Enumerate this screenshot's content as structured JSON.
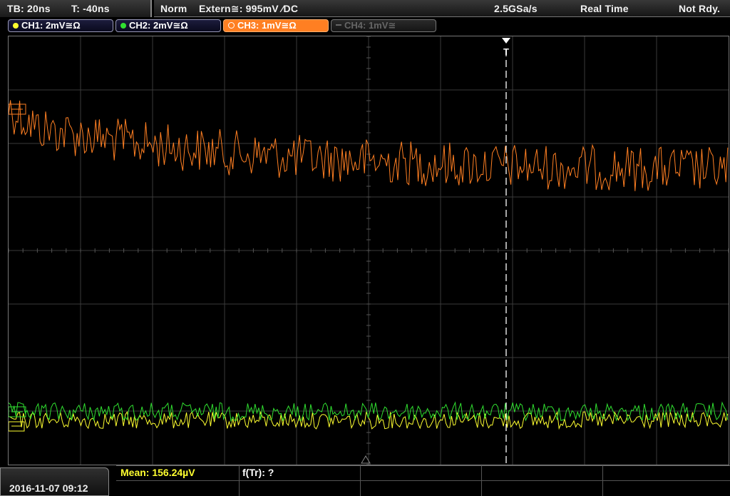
{
  "topbar": {
    "timebase": "TB: 20ns",
    "trigger_time": "T: -40ns",
    "mode": "Norm",
    "trigger_source": "Extern≅: 995mV",
    "trigger_edge": "∕DC",
    "sample_rate": "2.5GSa/s",
    "acq_mode": "Real Time",
    "status": "Not Rdy."
  },
  "channels": [
    {
      "label": "CH1: 2mV≅Ω",
      "color": "#ffff30",
      "state": "on"
    },
    {
      "label": "CH2: 2mV≅Ω",
      "color": "#30e030",
      "state": "on"
    },
    {
      "label": "CH3: 1mV≅Ω",
      "color": "#ff7f22",
      "state": "active"
    },
    {
      "label": "CH4: 1mV≅",
      "color": "#666666",
      "state": "off"
    }
  ],
  "plot": {
    "background": "#000000",
    "grid_color": "#3a3a3a",
    "trigger_marker": "T",
    "trace_colors": {
      "ch1": "#ffff30",
      "ch2": "#30e030",
      "ch3": "#ff7f22"
    }
  },
  "bottom": {
    "datetime": "2016-11-07 09:12",
    "mean": "Mean: 156.24µV",
    "ftr": "f(Tr): ?"
  }
}
